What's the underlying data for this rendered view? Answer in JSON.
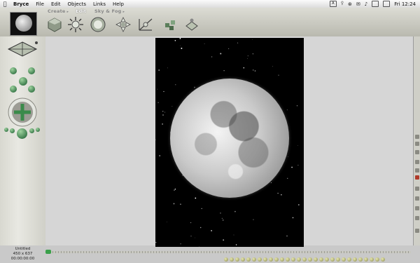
{
  "menubar": {
    "app_name": "Bryce",
    "items": [
      "File",
      "Edit",
      "Objects",
      "Links",
      "Help"
    ],
    "clock": "Fri 12:24",
    "status_symbols": [
      "⍢",
      "⊛",
      "✉",
      "♪"
    ]
  },
  "toolbar": {
    "tabs": [
      {
        "label": "Create",
        "arrow": "▸",
        "active": false
      },
      {
        "label": "Edit",
        "arrow": "",
        "active": true
      },
      {
        "label": "Sky & Fog",
        "arrow": "▸",
        "active": false
      }
    ],
    "tools": [
      "move-icon",
      "scale-icon",
      "rotate-icon",
      "reposition-icon",
      "align-icon",
      "randomize-icon",
      "material-icon"
    ]
  },
  "document": {
    "name": "Untitled",
    "dimensions": "450 x 637",
    "timecode": "00:00:00:00"
  },
  "colors": {
    "accent_green": "#3aa04a",
    "palette_gray": "#d8d8d0",
    "scene_bg": "#000000"
  }
}
